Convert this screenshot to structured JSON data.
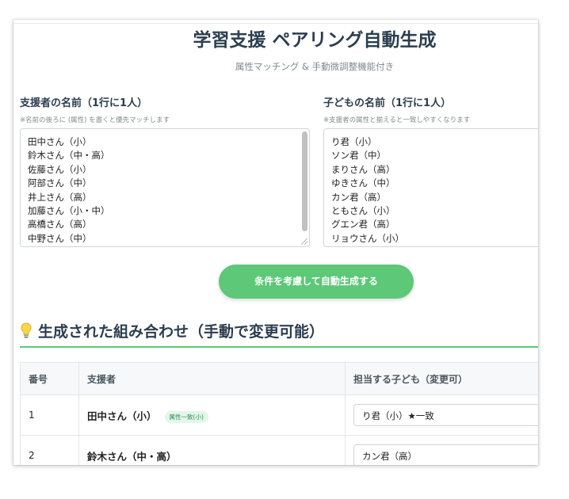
{
  "page": {
    "title": "学習支援 ペアリング自動生成",
    "subtitle": "属性マッチング & 手動微調整機能付き"
  },
  "supporters": {
    "label": "支援者の名前（1行に1人）",
    "hint": "※名前の後ろに (属性) を書くと優先マッチします",
    "lines": [
      "田中さん（小）",
      "鈴木さん（中・高）",
      "佐藤さん（小）",
      "阿部さん（中）",
      "井上さん（高）",
      "加藤さん（小・中）",
      "高橋さん（高）",
      "中野さん（中）"
    ]
  },
  "children": {
    "label": "子どもの名前（1行に1人）",
    "hint": "※支援者の属性と揃えると一致しやすくなります",
    "lines": [
      "り君（小）",
      "ソン君（中）",
      "まりさん（高）",
      "ゆきさん（中）",
      "カン君（高）",
      "ともさん（小）",
      "グエン君（高）",
      "リョウさん（小）"
    ]
  },
  "generate_button": "条件を考慮して自動生成する",
  "results": {
    "title": "生成された組み合わせ（手動で変更可能）",
    "icon": "lightbulb-icon",
    "headers": [
      "番号",
      "支援者",
      "担当する子ども（変更可）"
    ],
    "rows": [
      {
        "num": "1",
        "supporter": "田中さん（小）",
        "badge": "属性一致(小)",
        "child": "り君（小）★一致"
      },
      {
        "num": "2",
        "supporter": "鈴木さん（中・高）",
        "badge": "",
        "child": "カン君（高）"
      }
    ]
  },
  "colors": {
    "accent": "#5cc878",
    "badge_bg": "#e4f5e9",
    "badge_text": "#2e8b4e",
    "heading": "#2c3e50"
  }
}
